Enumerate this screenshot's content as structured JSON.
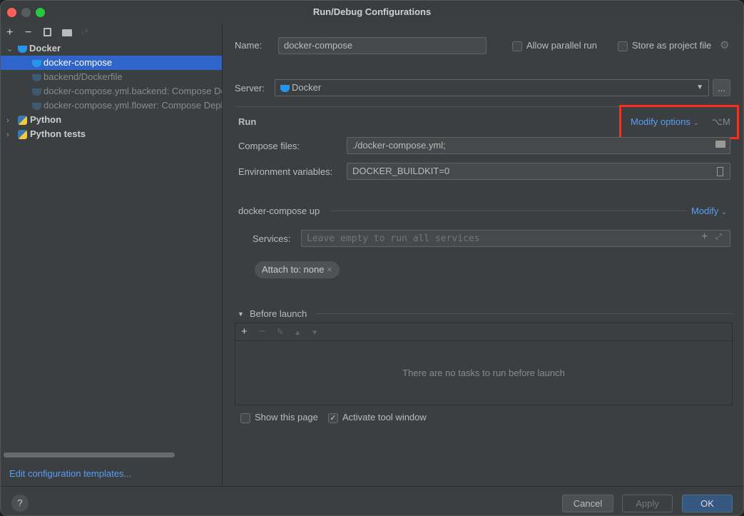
{
  "window": {
    "title": "Run/Debug Configurations"
  },
  "toolbar": {
    "add": "+",
    "remove": "−",
    "copy_icon": "copy-icon",
    "folder_icon": "new-folder-icon",
    "sort_icon": "sort-icon"
  },
  "tree": [
    {
      "label": "Docker",
      "level": 0,
      "expanded": true,
      "icon": "docker-icon"
    },
    {
      "label": "docker-compose",
      "level": 1,
      "selected": true,
      "icon": "docker-icon"
    },
    {
      "label": "backend/Dockerfile",
      "level": 1,
      "dim": true,
      "icon": "docker-icon"
    },
    {
      "label": "docker-compose.yml.backend: Compose Deployment",
      "level": 1,
      "dim": true,
      "icon": "docker-icon"
    },
    {
      "label": "docker-compose.yml.flower: Compose Deployment",
      "level": 1,
      "dim": true,
      "icon": "docker-icon"
    },
    {
      "label": "Python",
      "level": 0,
      "expanded": false,
      "icon": "python-icon"
    },
    {
      "label": "Python tests",
      "level": 0,
      "expanded": false,
      "icon": "python-tests-icon"
    }
  ],
  "edit_templates": "Edit configuration templates...",
  "form": {
    "name_label": "Name:",
    "name_value": "docker-compose",
    "allow_parallel": "Allow parallel run",
    "allow_parallel_checked": false,
    "store_project": "Store as project file",
    "store_project_checked": false,
    "server_label": "Server:",
    "server_value": "Docker",
    "more": "...",
    "run_heading": "Run",
    "modify_options": "Modify options",
    "modify_shortcut": "⌥M",
    "compose_label": "Compose files:",
    "compose_value": "./docker-compose.yml;",
    "env_label": "Environment variables:",
    "env_value": "DOCKER_BUILDKIT=0",
    "up_heading": "docker-compose up",
    "modify": "Modify",
    "services_label": "Services:",
    "services_placeholder": "Leave empty to run all services",
    "attach_chip": "Attach to: none",
    "before_launch": "Before launch",
    "no_tasks": "There are no tasks to run before launch",
    "show_page": "Show this page",
    "show_page_checked": false,
    "activate_tool": "Activate tool window",
    "activate_tool_checked": true
  },
  "footer": {
    "help": "?",
    "cancel": "Cancel",
    "apply": "Apply",
    "ok": "OK"
  },
  "colors": {
    "accent": "#589df6",
    "selection": "#2f65ca",
    "highlight_box": "#ff2a1f",
    "ok_button": "#365880"
  }
}
